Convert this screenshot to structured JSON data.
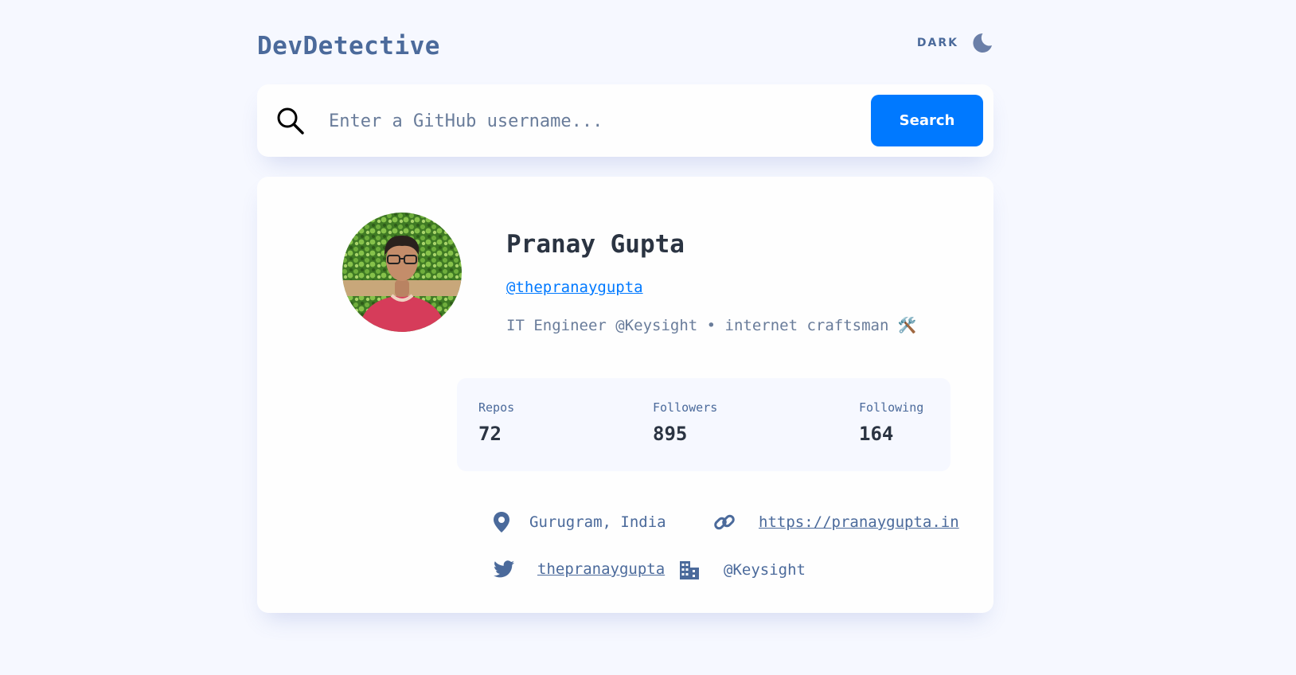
{
  "app": {
    "title": "DevDetective"
  },
  "theme_toggle": {
    "label": "DARK",
    "icon": "moon-icon"
  },
  "search": {
    "placeholder": "Enter a GitHub username...",
    "value": "",
    "button_label": "Search",
    "icon": "search-icon"
  },
  "profile": {
    "name": "Pranay Gupta",
    "login": "@thepranaygupta",
    "bio": "IT Engineer @Keysight • internet craftsman 🛠️",
    "stats": [
      {
        "label": "Repos",
        "value": "72"
      },
      {
        "label": "Followers",
        "value": "895"
      },
      {
        "label": "Following",
        "value": "164"
      }
    ],
    "links": {
      "location": "Gurugram, India",
      "website": "https://pranaygupta.in",
      "twitter": "thepranaygupta",
      "company": "@Keysight"
    }
  },
  "colors": {
    "background": "#f6f8ff",
    "card": "#fefefe",
    "accent": "#0079ff",
    "text_primary": "#2b3442",
    "text_secondary": "#4b6a9b",
    "text_muted": "#697c9a"
  }
}
